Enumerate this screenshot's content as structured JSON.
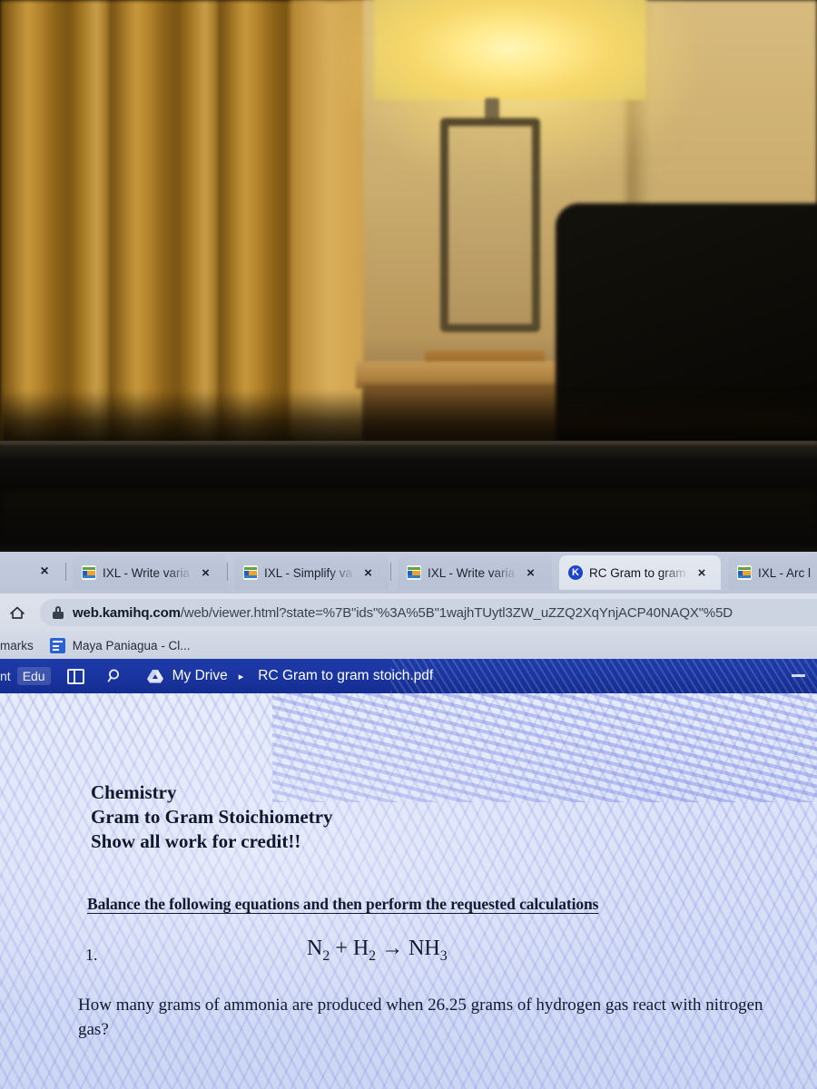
{
  "scene": {
    "description": "blurry photo of a hotel room: gold curtains, lit table lamp, wooden nightstand with remote, dark chair back",
    "colors": {
      "curtain": "#b07f28",
      "lamp_glow": "#ffe98a",
      "wall": "#cbae70",
      "dark_chair": "#0c0b07",
      "bezel": "#050505"
    }
  },
  "browser": {
    "tabs": [
      {
        "label": "IXL - Write varia",
        "favicon": "ixl-icon",
        "active": false,
        "truncated": true
      },
      {
        "label": "IXL - Simplify va",
        "favicon": "ixl-icon",
        "active": false,
        "truncated": true
      },
      {
        "label": "IXL - Write varia",
        "favicon": "ixl-icon",
        "active": false,
        "truncated": true
      },
      {
        "label": "RC Gram to gram",
        "favicon": "kami-icon",
        "favicon_letter": "K",
        "active": true,
        "truncated": true
      },
      {
        "label": "IXL - Arc l",
        "favicon": "ixl-icon",
        "active": false,
        "truncated": true
      }
    ],
    "tab_close_label": "×",
    "omnibox": {
      "home_icon": "home-icon",
      "lock_icon": "lock-icon",
      "url_host": "web.kamihq.com",
      "url_rest": "/web/viewer.html?state=%7B\"ids\"%3A%5B\"1wajhTUytl3ZW_uZZQ2XqYnjACP40NAQX\"%5D"
    },
    "bookmarks": {
      "overflow_label": "marks",
      "items": [
        {
          "label": "Maya Paniagua - Cl...",
          "icon": "doc-icon"
        }
      ]
    }
  },
  "kami": {
    "ent_label": "nt",
    "edu_badge": "Edu",
    "panel_icon": "split-panel-icon",
    "search_icon": "search-icon",
    "drive_icon": "google-drive-icon",
    "drive_label": "My Drive",
    "breadcrumb_caret": "▸",
    "filename": "RC Gram to gram stoich.pdf",
    "minimize_label": "–",
    "accent_color": "#1a35a0"
  },
  "document": {
    "header_lines": [
      "Chemistry",
      "Gram to Gram Stoichiometry",
      "Show all work for credit!!"
    ],
    "instruction": "Balance the following equations and then perform the requested calculations",
    "question_number": "1.",
    "equation": {
      "reactant_1": "N",
      "reactant_1_sub": "2",
      "plus": "+",
      "reactant_2": "H",
      "reactant_2_sub": "2",
      "arrow": "→",
      "product": "NH",
      "product_sub": "3",
      "full_text": "N2 + H2 → NH3"
    },
    "question_text": "How many grams of ammonia are produced when 26.25 grams of hydrogen gas react with nitrogen gas?"
  }
}
